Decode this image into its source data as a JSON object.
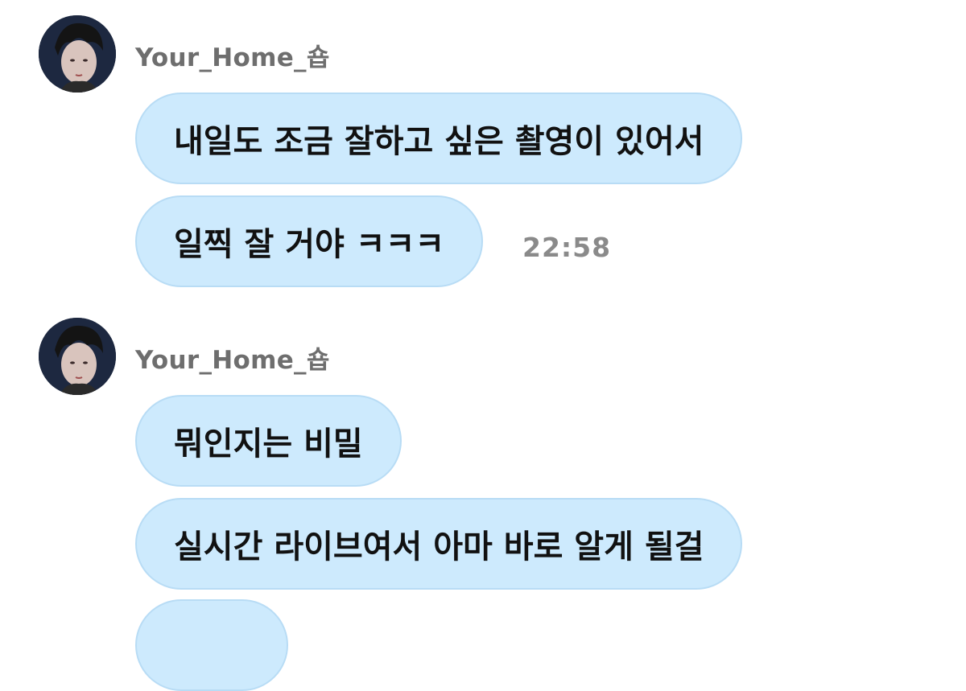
{
  "messages": [
    {
      "sender": "Your_Home_숍",
      "avatar_icon": "profile-photo-avatar",
      "bubbles": [
        "내일도 조금 잘하고 싶은 촬영이 있어서",
        "일찍 잘 거야 ㅋㅋㅋ"
      ],
      "time": "22:58"
    },
    {
      "sender": "Your_Home_숍",
      "avatar_icon": "profile-photo-avatar",
      "bubbles": [
        "뭐인지는 비밀",
        "실시간 라이브여서 아마 바로 알게 될걸"
      ]
    }
  ],
  "colors": {
    "bubble_bg": "#cdeafd",
    "bubble_border": "#b8dcf5",
    "sender_text": "#6e6e6e",
    "time_text": "#8a8a8a",
    "message_text": "#111111"
  }
}
